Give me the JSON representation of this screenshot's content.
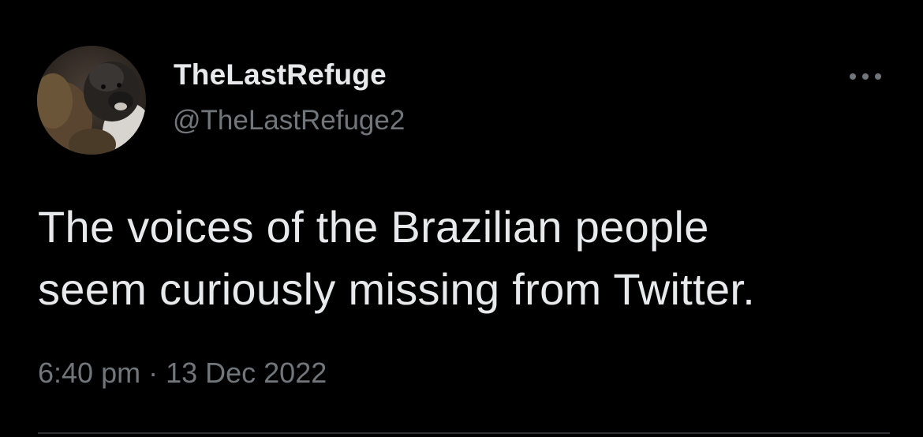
{
  "tweet": {
    "author": {
      "display_name": "TheLastRefuge",
      "handle": "@TheLastRefuge2",
      "avatar_icon": "dog-avatar"
    },
    "more_icon": "more-options-icon",
    "text_line_1": "The voices of the Brazilian people",
    "text_line_2": "seem curiously missing from Twitter.",
    "time": "6:40 pm",
    "separator": " · ",
    "date": "13 Dec 2022"
  },
  "colors": {
    "background": "#000000",
    "primary_text": "#e7e9ea",
    "secondary_text": "#71767b",
    "divider": "#2f3336"
  }
}
